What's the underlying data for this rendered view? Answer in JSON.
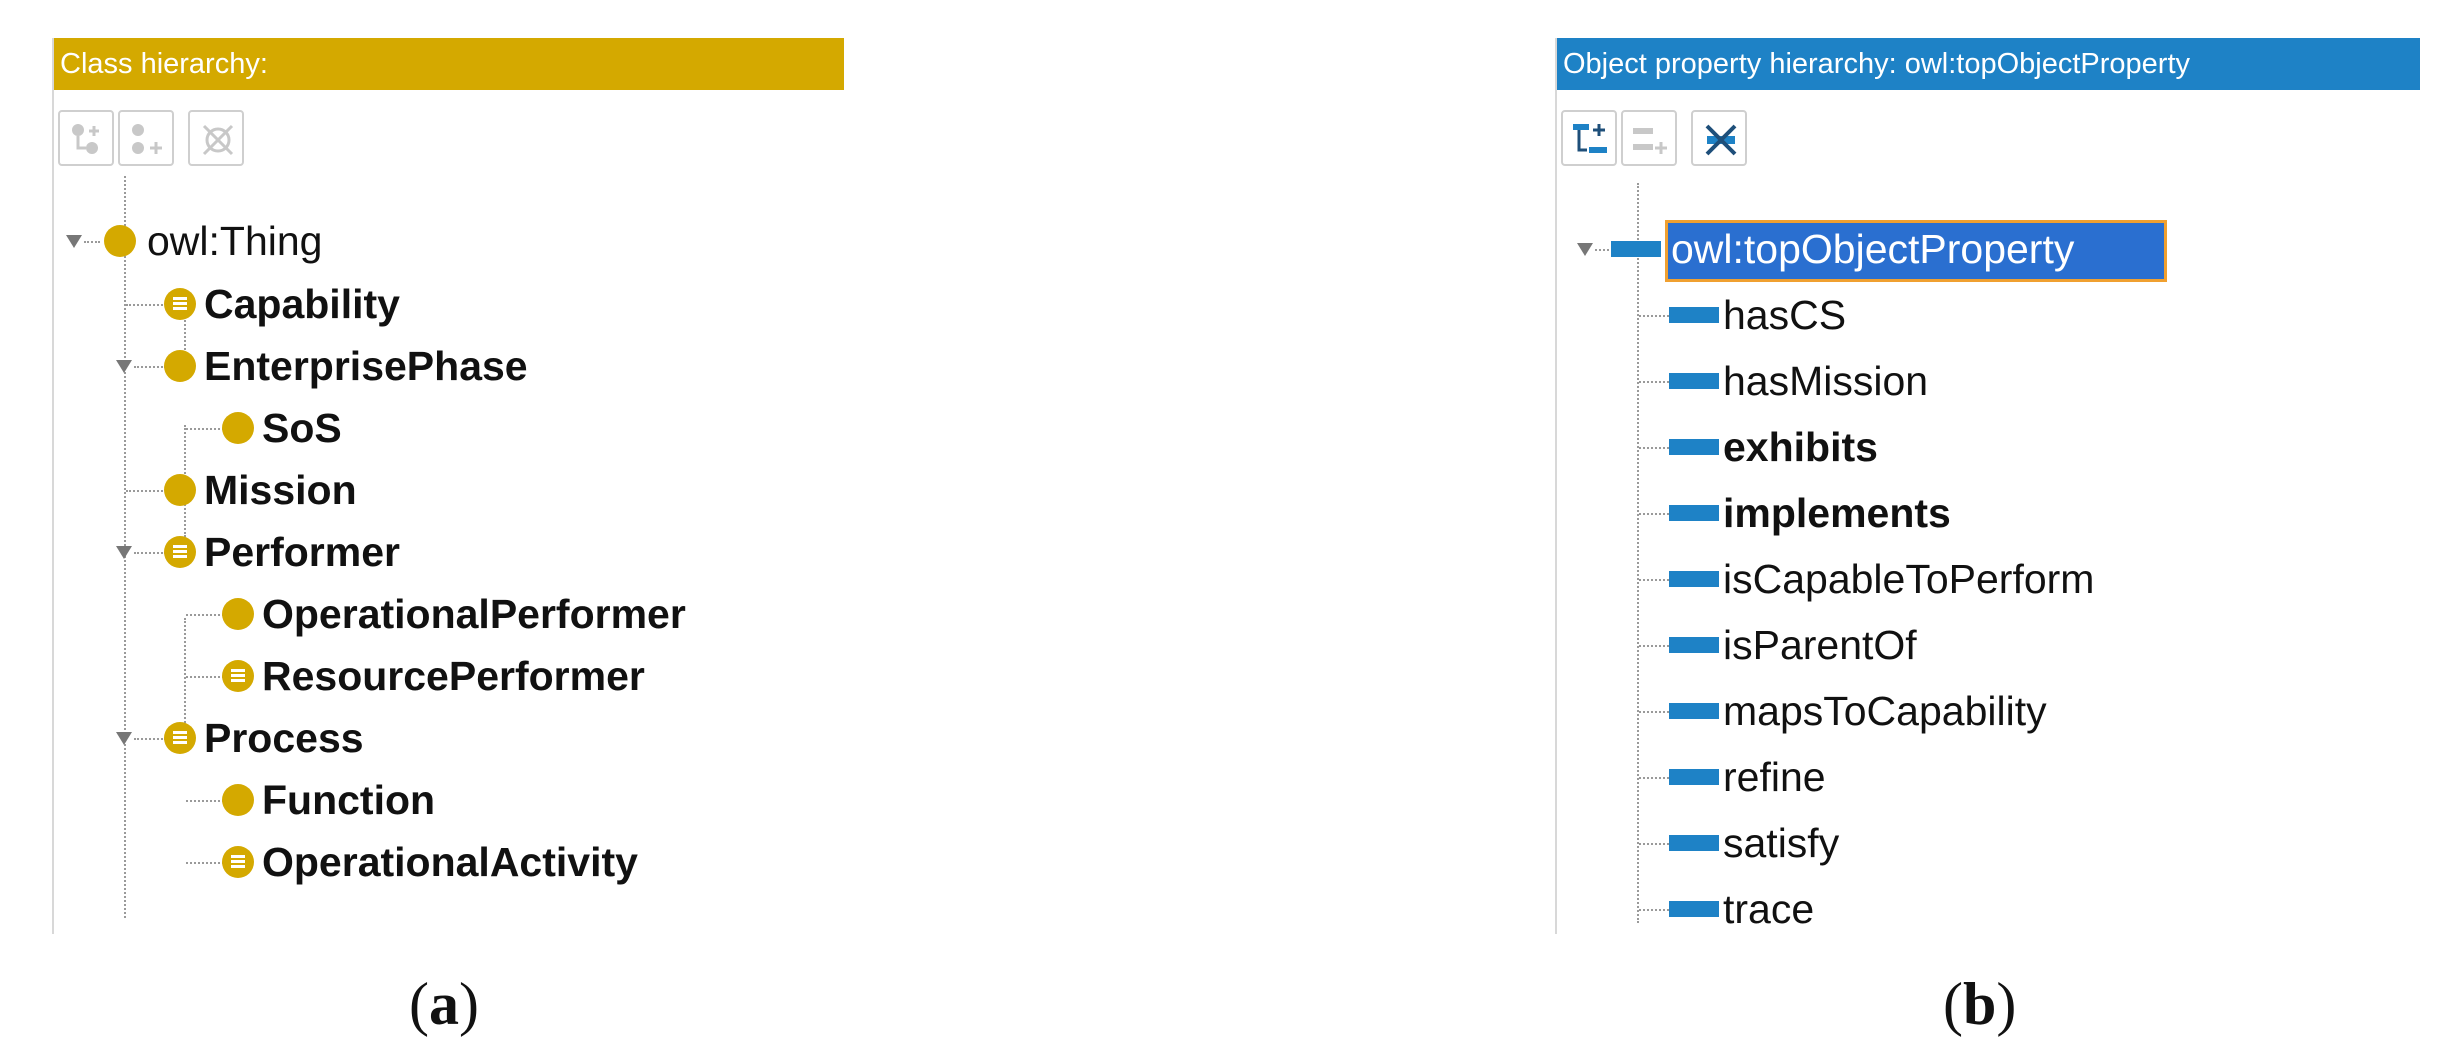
{
  "panel_a": {
    "title": "Class hierarchy:",
    "tree": {
      "root": "owl:Thing",
      "items": [
        "Capability",
        "EnterprisePhase",
        "SoS",
        "Mission",
        "Performer",
        "OperationalPerformer",
        "ResourcePerformer",
        "Process",
        "Function",
        "OperationalActivity"
      ]
    },
    "caption": {
      "open": "(",
      "letter": "a",
      "close": ")"
    },
    "colors": {
      "title_bg": "#d4a900",
      "class_dot": "#d4a900"
    }
  },
  "panel_b": {
    "title": "Object property hierarchy: owl:topObjectProperty",
    "tree": {
      "root": "owl:topObjectProperty",
      "items": [
        "hasCS",
        "hasMission",
        "exhibits",
        "implements",
        "isCapableToPerform",
        "isParentOf",
        "mapsToCapability",
        "refine",
        "satisfy",
        "trace"
      ]
    },
    "caption": {
      "open": "(",
      "letter": "b",
      "close": ")"
    },
    "colors": {
      "title_bg": "#1e82c6",
      "property_bar": "#1e82c6",
      "selection_border": "#f0a030"
    }
  },
  "icons": [
    "add-subclass-icon",
    "add-sibling-icon",
    "delete-icon",
    "add-subproperty-icon",
    "add-sibling-property-icon",
    "delete-property-icon",
    "class-icon",
    "defined-class-icon",
    "object-property-icon",
    "expand-triangle-icon"
  ]
}
